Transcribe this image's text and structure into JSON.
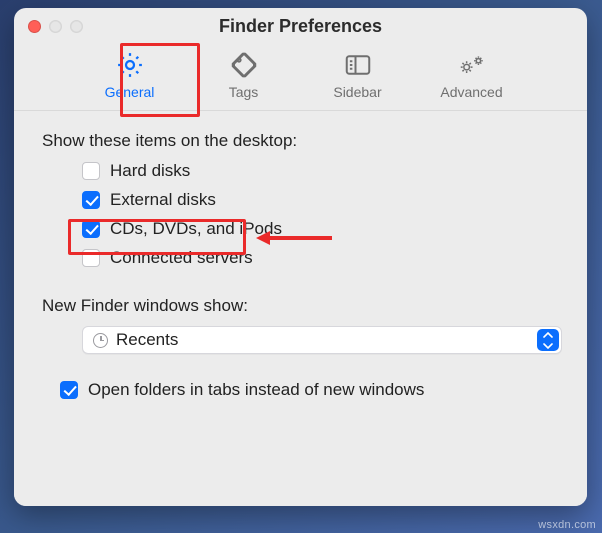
{
  "window": {
    "title": "Finder Preferences"
  },
  "tabs": {
    "general": "General",
    "tags": "Tags",
    "sidebar": "Sidebar",
    "advanced": "Advanced"
  },
  "desktop_items": {
    "label": "Show these items on the desktop:",
    "hard_disks": "Hard disks",
    "external_disks": "External disks",
    "cds": "CDs, DVDs, and iPods",
    "connected_servers": "Connected servers"
  },
  "new_window": {
    "label": "New Finder windows show:",
    "value": "Recents"
  },
  "open_in_tabs": "Open folders in tabs instead of new windows",
  "watermark": "wsxdn.com"
}
